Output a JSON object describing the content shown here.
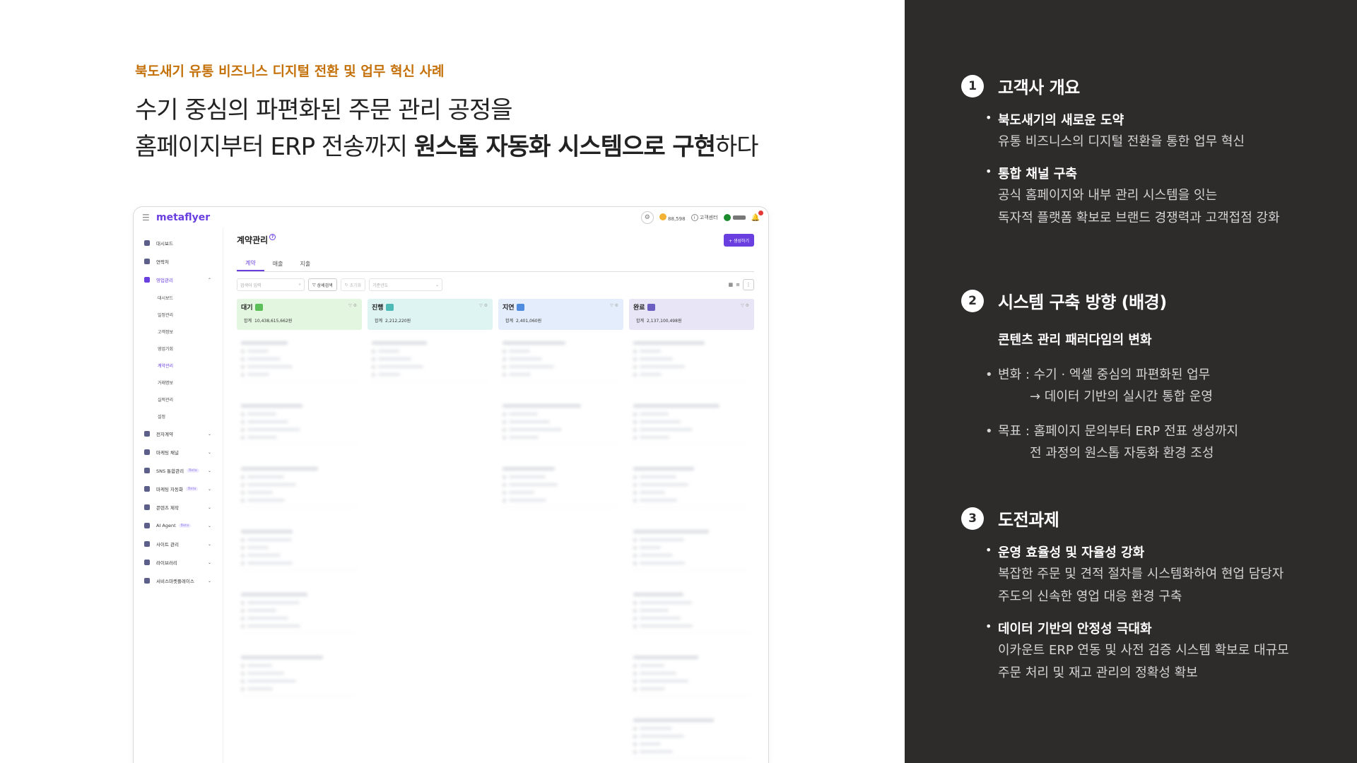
{
  "left": {
    "eyebrow": "북도새기 유통 비즈니스 디지털 전환 및 업무 혁신 사례",
    "headline_line1": "수기 중심의 파편화된 주문 관리 공정을",
    "headline_line2_pre": "홈페이지부터 ERP 전송까지 ",
    "headline_line2_bold": "원스톱 자동화 시스템으로 구현",
    "headline_line2_post": "하다"
  },
  "mock": {
    "logo": "metaflyer",
    "credits": "88,598",
    "support_label": "고객센터",
    "page_title": "계약관리",
    "create_button": "+ 생성하기",
    "tabs": [
      "계약",
      "매출",
      "지출"
    ],
    "search_placeholder": "검색어 입력",
    "detail_filter": "상세검색",
    "reset": "초기화",
    "year_select": "기준년도",
    "sidebar": [
      {
        "label": "대시보드",
        "expand": false
      },
      {
        "label": "연락처",
        "expand": false
      },
      {
        "label": "영업관리",
        "expand": true,
        "active": true
      }
    ],
    "sidebar_sub": [
      "대시보드",
      "일정관리",
      "고객정보",
      "영업기회",
      "계약관리",
      "거래명보",
      "실적관리",
      "설정"
    ],
    "sidebar_after": [
      {
        "label": "전자계약",
        "beta": false
      },
      {
        "label": "마케팅 채널",
        "beta": false
      },
      {
        "label": "SNS 통합관리",
        "beta": true
      },
      {
        "label": "마케팅 자동화",
        "beta": true
      },
      {
        "label": "콘텐츠 제작",
        "beta": false
      },
      {
        "label": "AI Agent",
        "beta": true
      },
      {
        "label": "사이트 관리",
        "beta": false
      },
      {
        "label": "라이브러리",
        "beta": false
      },
      {
        "label": "서비스마켓플레이스",
        "beta": false
      }
    ],
    "beta_label": "Beta",
    "sum_label": "합계",
    "columns": [
      {
        "title": "대기",
        "sum": "10,438,615,662원",
        "bg": "#e3f6e0",
        "badge": "#5cbf5a"
      },
      {
        "title": "진행",
        "sum": "2,212,220원",
        "bg": "#def4f3",
        "badge": "#4dbab6"
      },
      {
        "title": "지연",
        "sum": "2,401,060원",
        "bg": "#e3edfb",
        "badge": "#4f8ce0"
      },
      {
        "title": "완료",
        "sum": "2,137,100,498원",
        "bg": "#e8e6f6",
        "badge": "#6a5fc0"
      }
    ]
  },
  "right": {
    "s1": {
      "num": "1",
      "title": "고객사 개요",
      "items": [
        {
          "title": "북도새기의 새로운 도약",
          "lines": [
            "유통 비즈니스의 디지털 전환을 통한 업무 혁신"
          ]
        },
        {
          "title": "통합 채널 구축",
          "lines": [
            "공식 홈페이지와 내부 관리 시스템을 잇는",
            "독자적 플랫폼 확보로 브랜드 경쟁력과 고객접점 강화"
          ]
        }
      ]
    },
    "s2": {
      "num": "2",
      "title": "시스템 구축 방향 (배경)",
      "subtitle": "콘텐츠 관리 패러다임의 변화",
      "item1_line1": "변화 : 수기 · 엑셀 중심의 파편화된 업무",
      "item1_line2": "→ 데이터 기반의 실시간 통합 운영",
      "item2_line1": "목표 : 홈페이지 문의부터 ERP 전표 생성까지",
      "item2_line2": "전 과정의 원스톱 자동화 환경 조성"
    },
    "s3": {
      "num": "3",
      "title": "도전과제",
      "items": [
        {
          "title": "운영 효율성 및 자율성 강화",
          "lines": [
            "복잡한 주문 및 견적 절차를 시스템화하여 현업 담당자",
            "주도의 신속한 영업 대응 환경 구축"
          ]
        },
        {
          "title": "데이터 기반의 안정성 극대화",
          "lines": [
            "이카운트 ERP 연동 및 사전 검증 시스템 확보로 대규모",
            "주문 처리 및 재고 관리의 정확성 확보"
          ]
        }
      ]
    }
  }
}
